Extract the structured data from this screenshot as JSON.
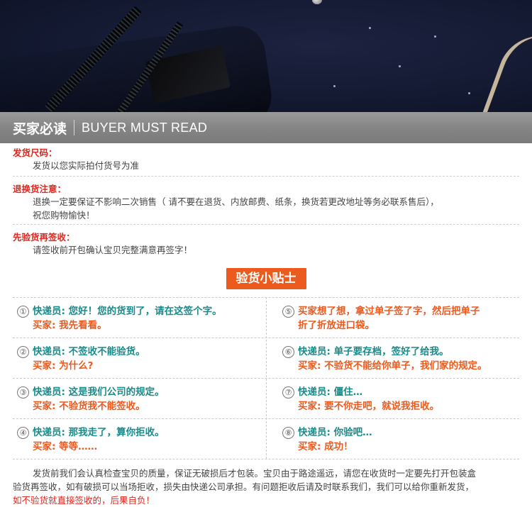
{
  "header": {
    "title_cn": "买家必读",
    "title_en": "BUYER MUST READ"
  },
  "sections": [
    {
      "title": "发货尺码：",
      "lines": [
        "发货以您实际拍付货号为准"
      ]
    },
    {
      "title": "退换货注意：",
      "lines": [
        "退换一定要保证不影响二次销售（ 请不要在退货、内放邮费、纸条，换货若更改地址等务必联系售后），",
        "祝您购物愉快！"
      ]
    },
    {
      "title": "先验货再签收：",
      "lines": [
        "请签收前开包确认宝贝完整满意再签字！"
      ]
    }
  ],
  "tips_label": "验货小贴士",
  "dialogs": [
    {
      "num": "①",
      "l1": "快递员: 您好！您的货到了，请在这签个字。",
      "l2": "买家: 我先看看。",
      "c1": "teal",
      "c2": "orange"
    },
    {
      "num": "⑤",
      "l1": "买家想了想，拿过单子签了字，然后把单子",
      "l2": "折了折放进口袋。",
      "c1": "orange",
      "c2": "orange"
    },
    {
      "num": "②",
      "l1": "快递员: 不签收不能验货。",
      "l2": "买家: 为什么?",
      "c1": "teal",
      "c2": "orange"
    },
    {
      "num": "⑥",
      "l1": "快递员: 单子要存档，签好了给我。",
      "l2": "买家: 不验货不能给你单子，我们家的规定。",
      "c1": "teal",
      "c2": "orange"
    },
    {
      "num": "③",
      "l1": "快递员: 这是我们公司的规定。",
      "l2": "买家: 不验货我不能签收。",
      "c1": "teal",
      "c2": "orange"
    },
    {
      "num": "⑦",
      "l1": "快递员: 僵住…",
      "l2": "买家: 要不你走吧，就说我拒收。",
      "c1": "teal",
      "c2": "orange"
    },
    {
      "num": "④",
      "l1": "快递员: 那我走了，算你拒收。",
      "l2": "买家: 等等……",
      "c1": "teal",
      "c2": "orange"
    },
    {
      "num": "⑧",
      "l1": "快递员: 你验吧…",
      "l2": "买家: 成功！",
      "c1": "teal",
      "c2": "orange"
    }
  ],
  "footer": {
    "line1": "发货前我们会认真检查宝贝的质量，保证无破损后才包装。宝贝由于路途遥远，请您在收货时一定要先打开包装盒",
    "line2": "验货再签收，如有破损可以当场拒收，损失由快递公司承担。有问题拒收后请及时联系我们，我们可以给你重新发货，",
    "line3": "如不验货就直接签收的，后果自负！"
  },
  "colors": {
    "accent": "#ec5a1e",
    "red": "#e2261d",
    "teal": "#1b8a8a",
    "header_bg": "#858585"
  }
}
